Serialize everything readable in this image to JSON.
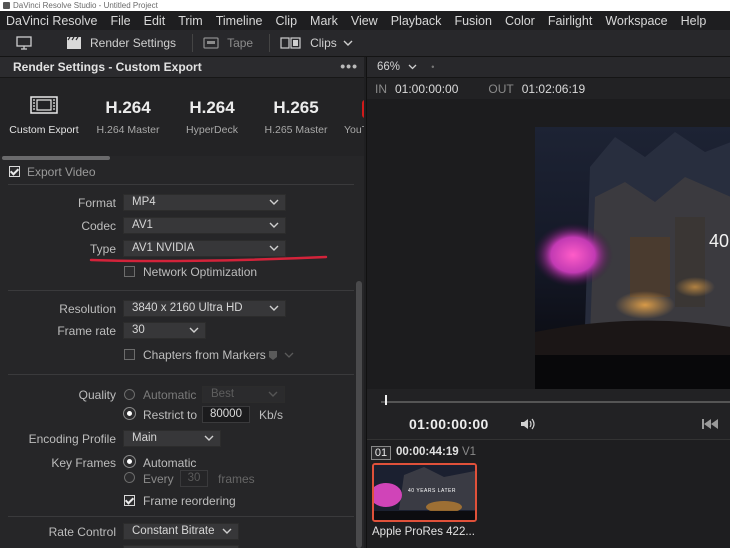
{
  "window": {
    "title": "DaVinci Resolve Studio - Untitled Project"
  },
  "menu": [
    "DaVinci Resolve",
    "File",
    "Edit",
    "Trim",
    "Timeline",
    "Clip",
    "Mark",
    "View",
    "Playback",
    "Fusion",
    "Color",
    "Fairlight",
    "Workspace",
    "Help"
  ],
  "toolbar": {
    "render_settings": "Render Settings",
    "tape": "Tape",
    "clips": "Clips"
  },
  "render_panel": {
    "title": "Render Settings - Custom Export",
    "menu_dots": "•••",
    "presets": [
      {
        "big": "",
        "label": "Custom Export"
      },
      {
        "big": "H.264",
        "label": "H.264 Master"
      },
      {
        "big": "H.264",
        "label": "HyperDeck"
      },
      {
        "big": "H.265",
        "label": "H.265 Master"
      },
      {
        "big": "",
        "label": "YouT"
      }
    ],
    "export_video": "Export Video",
    "format": {
      "label": "Format",
      "value": "MP4"
    },
    "codec": {
      "label": "Codec",
      "value": "AV1"
    },
    "type": {
      "label": "Type",
      "value": "AV1 NVIDIA"
    },
    "network_optimization": "Network Optimization",
    "resolution": {
      "label": "Resolution",
      "value": "3840 x 2160 Ultra HD"
    },
    "frame_rate": {
      "label": "Frame rate",
      "value": "30"
    },
    "chapters": "Chapters from Markers",
    "quality": {
      "label": "Quality",
      "automatic": "Automatic",
      "best": "Best",
      "restrict": "Restrict to",
      "value": "80000",
      "unit": "Kb/s"
    },
    "encoding_profile": {
      "label": "Encoding Profile",
      "value": "Main"
    },
    "key_frames": {
      "label": "Key Frames",
      "automatic": "Automatic",
      "every": "Every",
      "every_value": "30",
      "frames": "frames"
    },
    "frame_reordering": "Frame reordering",
    "rate_control": {
      "label": "Rate Control",
      "value": "Constant Bitrate"
    }
  },
  "viewer": {
    "zoom": "66%",
    "in_label": "IN",
    "in_tc": "01:00:00:00",
    "out_label": "OUT",
    "out_tc": "01:02:06:19",
    "overlay_text": "40",
    "timecode": "01:00:00:00"
  },
  "clips": {
    "index": "01",
    "timecode": "00:00:44:19",
    "track": "V1",
    "thumb_caption": "40 YEARS LATER",
    "name": "Apple ProRes 422..."
  },
  "colors": {
    "accent_red": "#d3233a",
    "clip_border": "#e0513a"
  }
}
